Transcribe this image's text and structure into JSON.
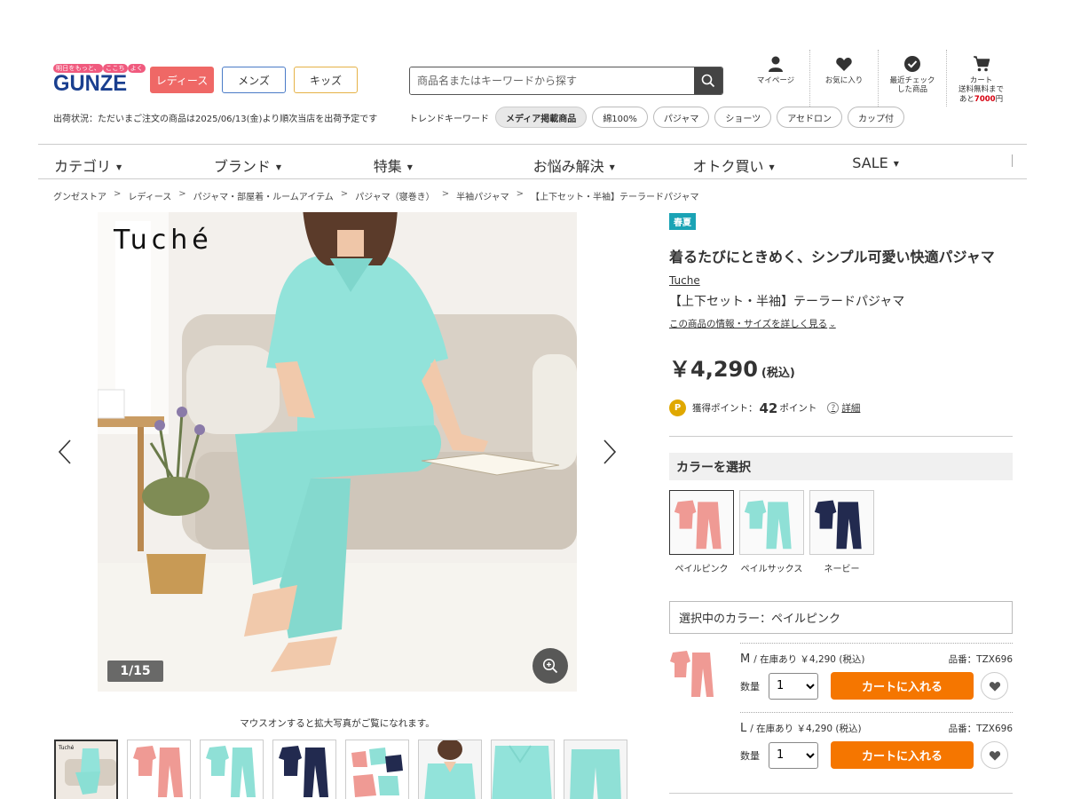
{
  "header": {
    "logo_tagline_pre": "明日をもっと、",
    "logo_tagline_mark": "ここち",
    "logo_tagline_post": "よく",
    "logo_word": "GUNZE",
    "gender_tabs": [
      "レディース",
      "メンズ",
      "キッズ"
    ],
    "ship_notice": "出荷状況：ただいまご注文の商品は2025/06/13(金)より順次当店を出荷予定です",
    "search_placeholder": "商品名またはキーワードから探す",
    "trend_label": "トレンドキーワード",
    "trend_tags": [
      "メディア掲載商品",
      "綿100%",
      "パジャマ",
      "ショーツ",
      "アセドロン",
      "カップ付"
    ],
    "icons": {
      "mypage": "マイページ",
      "favorites": "お気に入り",
      "recent_line1": "最近チェック",
      "recent_line2": "した商品",
      "cart": "カート",
      "cart_sub1": "送料無料まで",
      "cart_sub2_pre": "あと",
      "cart_sub2_amount": "7000",
      "cart_sub2_post": "円"
    }
  },
  "nav": [
    "カテゴリ",
    "ブランド",
    "特集",
    "お悩み解決",
    "オトク買い",
    "SALE"
  ],
  "breadcrumb": [
    "グンゼストア",
    "レディース",
    "パジャマ・部屋着・ルームアイテム",
    "パジャマ（寝巻き）",
    "半袖パジャマ",
    "【上下セット・半袖】テーラードパジャマ"
  ],
  "gallery": {
    "brand_overlay": "Tuché",
    "counter": "1/15",
    "zoom_hint": "マウスオンすると拡大写真がご覧になれます。",
    "thumb_count": 8
  },
  "product": {
    "season_badge": "春夏",
    "catchcopy": "着るたびにときめく、シンプル可愛い快適パジャマ",
    "brand": "Tuche",
    "name": "【上下セット・半袖】テーラードパジャマ",
    "detail_link": "この商品の情報・サイズを詳しく見る",
    "price": "￥4,290",
    "tax": "(税込)",
    "points_label": "獲得ポイント：",
    "points_value": "42",
    "points_unit": "ポイント",
    "points_help": "詳細",
    "color_heading": "カラーを選択",
    "colors": [
      {
        "name": "ペイルピンク",
        "hex": "#ef9a94"
      },
      {
        "name": "ペイルサックス",
        "hex": "#8fe0d6"
      },
      {
        "name": "ネービー",
        "hex": "#222a4f"
      }
    ],
    "selected_color_text": "選択中のカラー：ペイルピンク",
    "variants": [
      {
        "size": "M",
        "stock": "/ 在庫あり ￥4,290 (税込)",
        "sku": "品番：TZX696",
        "qty_label": "数量",
        "qty": "1",
        "cart_label": "カートに入れる"
      },
      {
        "size": "L",
        "stock": "/ 在庫あり ￥4,290 (税込)",
        "sku": "品番：TZX696",
        "qty_label": "数量",
        "qty": "1",
        "cart_label": "カートに入れる"
      }
    ]
  },
  "colors": {
    "accent_orange": "#f57600",
    "brand_blue": "#1a3f8f",
    "ladies_red": "#ef6866",
    "season_teal": "#1aa3b5"
  }
}
